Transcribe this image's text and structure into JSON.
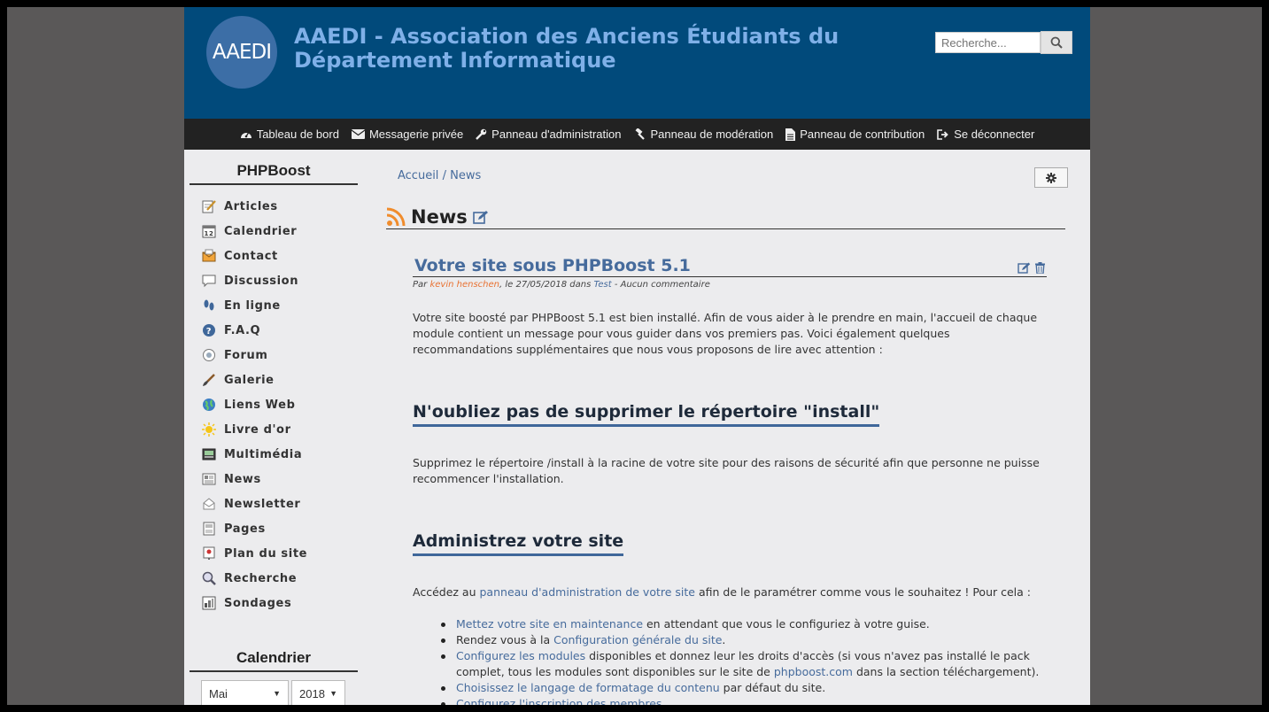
{
  "header": {
    "logo_text": "AAEDI",
    "title": "AAEDI - Association des Anciens Étudiants du Département Informatique",
    "search_placeholder": "Recherche..."
  },
  "topnav": [
    {
      "label": "Tableau de bord",
      "icon": "dashboard-icon"
    },
    {
      "label": "Messagerie privée",
      "icon": "envelope-icon"
    },
    {
      "label": "Panneau d'administration",
      "icon": "wrench-icon"
    },
    {
      "label": "Panneau de modération",
      "icon": "gavel-icon"
    },
    {
      "label": "Panneau de contribution",
      "icon": "file-icon"
    },
    {
      "label": "Se déconnecter",
      "icon": "sign-out-icon"
    }
  ],
  "sidebar": {
    "title": "PHPBoost",
    "items": [
      {
        "label": "Articles"
      },
      {
        "label": "Calendrier"
      },
      {
        "label": "Contact"
      },
      {
        "label": "Discussion"
      },
      {
        "label": "En ligne"
      },
      {
        "label": "F.A.Q"
      },
      {
        "label": "Forum"
      },
      {
        "label": "Galerie"
      },
      {
        "label": "Liens Web"
      },
      {
        "label": "Livre d'or"
      },
      {
        "label": "Multimédia"
      },
      {
        "label": "News"
      },
      {
        "label": "Newsletter"
      },
      {
        "label": "Pages"
      },
      {
        "label": "Plan du site"
      },
      {
        "label": "Recherche"
      },
      {
        "label": "Sondages"
      }
    ],
    "calendar_title": "Calendrier",
    "month_selected": "Mai",
    "year_selected": "2018"
  },
  "breadcrumb": {
    "home": "Accueil",
    "separator": "/",
    "current": "News"
  },
  "module": {
    "title": "News"
  },
  "article": {
    "title": "Votre site sous PHPBoost 5.1",
    "meta_by": "Par",
    "author": "kevin henschen",
    "meta_date": ", le 27/05/2018 dans",
    "category": "Test",
    "meta_comments": "- Aucun commentaire",
    "intro": "Votre site boosté par PHPBoost 5.1 est bien installé. Afin de vous aider à le prendre en main, l'accueil de chaque module contient un message pour vous guider dans vos premiers pas. Voici également quelques recommandations supplémentaires que nous vous proposons de lire avec attention :",
    "h2_install": "N'oubliez pas de supprimer le répertoire \"install\"",
    "install_text": "Supprimez le répertoire /install à la racine de votre site pour des raisons de sécurité afin que personne ne puisse recommencer l'installation.",
    "h2_admin": "Administrez votre site",
    "admin_pre": "Accédez au",
    "admin_link": "panneau d'administration de votre site",
    "admin_post": "afin de le paramétrer comme vous le souhaitez ! Pour cela :",
    "list": [
      {
        "link": "Mettez votre site en maintenance",
        "pre": "",
        "post": " en attendant que vous le configuriez à votre guise."
      },
      {
        "pre": "Rendez vous à la ",
        "link": "Configuration générale du site",
        "post": "."
      },
      {
        "pre": "",
        "link": "Configurez les modules",
        "post": " disponibles et donnez leur les droits d'accès (si vous n'avez pas installé le pack complet, tous les modules sont disponibles sur le site de ",
        "link2": "phpboost.com",
        "post2": " dans la section téléchargement)."
      },
      {
        "pre": "",
        "link": "Choisissez le langage de formatage du contenu",
        "post": " par défaut du site."
      },
      {
        "pre": "",
        "link": "Configurez l'inscription des membres",
        "post": "."
      }
    ]
  },
  "colors": {
    "header_bg": "#014a7b",
    "title": "#7fb0e8",
    "nav_bg": "#222222",
    "link": "#466b9c",
    "author": "#e87131"
  }
}
